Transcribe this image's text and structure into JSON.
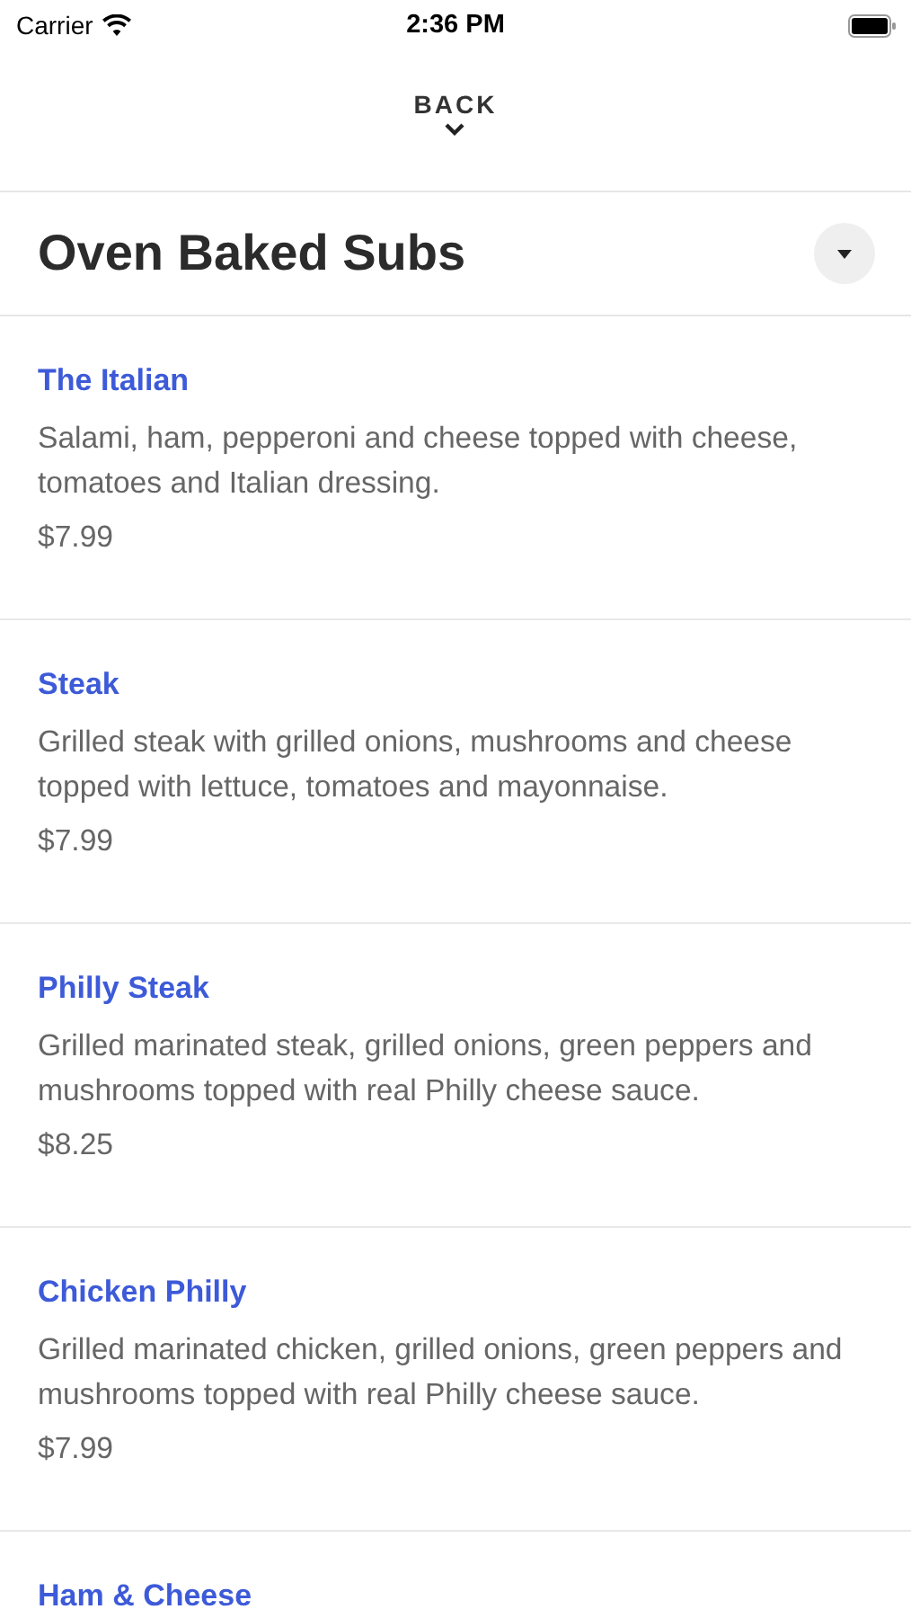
{
  "status_bar": {
    "carrier": "Carrier",
    "time": "2:36 PM"
  },
  "back": {
    "label": "BACK"
  },
  "header": {
    "title": "Oven Baked Subs",
    "expanded": false
  },
  "items": [
    {
      "name": "The Italian",
      "description": "Salami, ham, pepperoni and cheese topped with cheese, tomatoes and Italian dressing.",
      "price": "$7.99"
    },
    {
      "name": "Steak",
      "description": "Grilled steak with grilled onions, mushrooms and cheese topped with lettuce, tomatoes and mayonnaise.",
      "price": "$7.99"
    },
    {
      "name": "Philly Steak",
      "description": "Grilled marinated steak, grilled onions, green peppers and mushrooms topped with real Philly cheese sauce.",
      "price": "$8.25"
    },
    {
      "name": "Chicken Philly",
      "description": "Grilled marinated chicken, grilled onions, green peppers and mushrooms topped with real Philly cheese sauce.",
      "price": "$7.99"
    },
    {
      "name": "Ham & Cheese"
    }
  ]
}
